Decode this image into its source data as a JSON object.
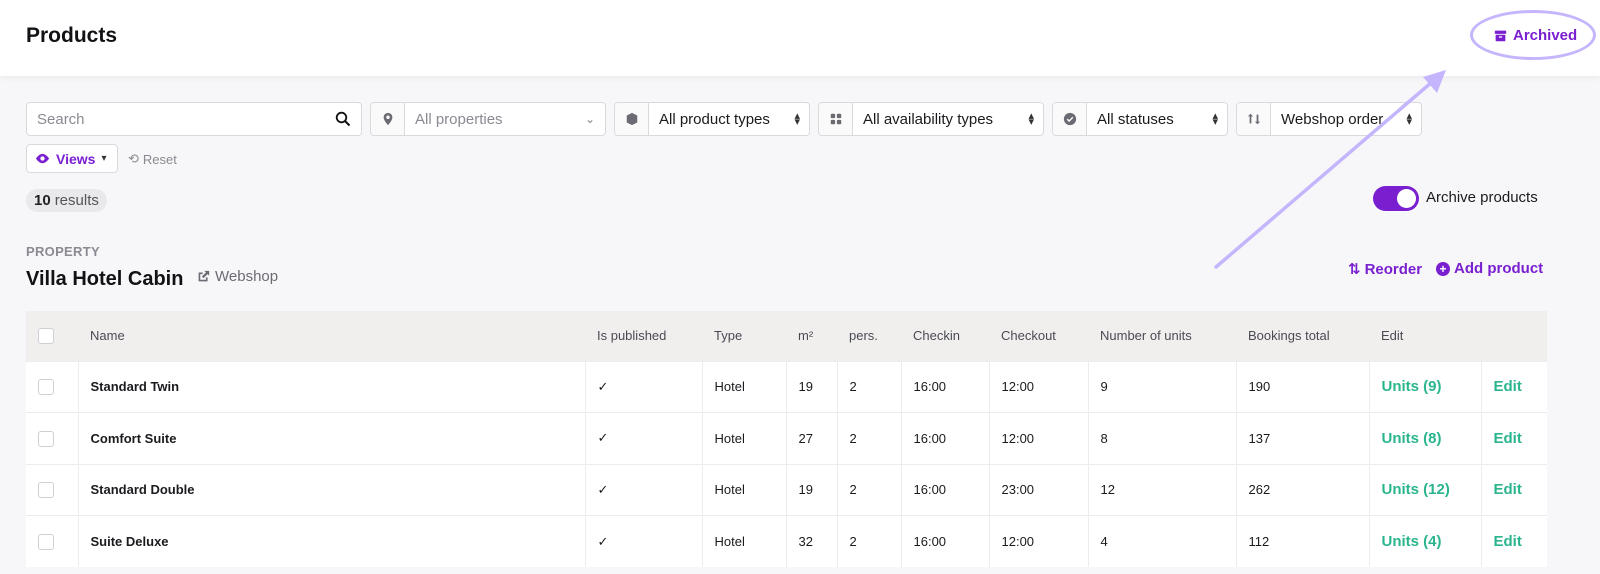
{
  "header": {
    "title": "Products",
    "archived_label": "Archived"
  },
  "filters": {
    "search_placeholder": "Search",
    "property": "All properties",
    "product_type": "All product types",
    "availability_type": "All availability types",
    "status": "All statuses",
    "order": "Webshop order"
  },
  "views_label": "Views",
  "reset_label": "Reset",
  "results": {
    "count": "10",
    "label": "results"
  },
  "archive_toggle": {
    "label": "Archive products",
    "on": true
  },
  "section": {
    "eyebrow": "PROPERTY",
    "title": "Villa Hotel Cabin",
    "webshop_label": "Webshop",
    "reorder_label": "Reorder",
    "add_label": "Add product"
  },
  "table": {
    "columns": [
      "Name",
      "Is published",
      "Type",
      "m²",
      "pers.",
      "Checkin",
      "Checkout",
      "Number of units",
      "Bookings total",
      "Edit"
    ],
    "rows": [
      {
        "name": "Standard Twin",
        "published": "✓",
        "type": "Hotel",
        "m2": "19",
        "pers": "2",
        "checkin": "16:00",
        "checkout": "12:00",
        "units": "9",
        "bookings": "190",
        "units_link": "Units (9)",
        "edit": "Edit"
      },
      {
        "name": "Comfort Suite",
        "published": "✓",
        "type": "Hotel",
        "m2": "27",
        "pers": "2",
        "checkin": "16:00",
        "checkout": "12:00",
        "units": "8",
        "bookings": "137",
        "units_link": "Units (8)",
        "edit": "Edit"
      },
      {
        "name": "Standard Double",
        "published": "✓",
        "type": "Hotel",
        "m2": "19",
        "pers": "2",
        "checkin": "16:00",
        "checkout": "23:00",
        "units": "12",
        "bookings": "262",
        "units_link": "Units (12)",
        "edit": "Edit"
      },
      {
        "name": "Suite Deluxe",
        "published": "✓",
        "type": "Hotel",
        "m2": "32",
        "pers": "2",
        "checkin": "16:00",
        "checkout": "12:00",
        "units": "4",
        "bookings": "112",
        "units_link": "Units (4)",
        "edit": "Edit"
      }
    ]
  },
  "colors": {
    "accent": "#7a1fd0",
    "link_green": "#2bb58e",
    "annotation": "#c4b5fd"
  }
}
